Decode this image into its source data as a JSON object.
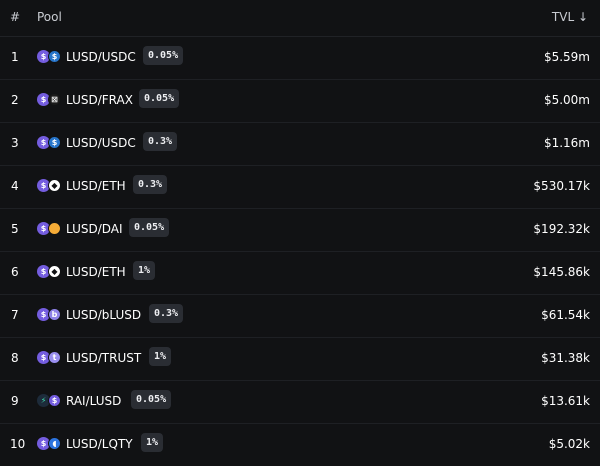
{
  "header": {
    "rank_label": "#",
    "pool_label": "Pool",
    "tvl_label": "TVL ↓"
  },
  "colors": {
    "background": "#111214",
    "lusd": "#745ddf",
    "usdc": "#2775ca",
    "frax": "#1b1b1b",
    "eth": "#ffffff",
    "dai": "#f5ac37",
    "blusd": "#8f83e8",
    "trust": "#9a8ff0",
    "rai": "#1d2b3a",
    "lqty": "#2c74e0",
    "fee_badge": "#2a2d33"
  },
  "rows": [
    {
      "rank": "1",
      "pair": "LUSD/USDC",
      "fee": "0.05%",
      "tvl": "$5.59m",
      "icons": [
        "lusd-icon",
        "usdc-icon"
      ]
    },
    {
      "rank": "2",
      "pair": "LUSD/FRAX",
      "fee": "0.05%",
      "tvl": "$5.00m",
      "icons": [
        "lusd-icon",
        "frax-icon"
      ]
    },
    {
      "rank": "3",
      "pair": "LUSD/USDC",
      "fee": "0.3%",
      "tvl": "$1.16m",
      "icons": [
        "lusd-icon",
        "usdc-icon"
      ]
    },
    {
      "rank": "4",
      "pair": "LUSD/ETH",
      "fee": "0.3%",
      "tvl": "$530.17k",
      "icons": [
        "lusd-icon",
        "eth-icon"
      ]
    },
    {
      "rank": "5",
      "pair": "LUSD/DAI",
      "fee": "0.05%",
      "tvl": "$192.32k",
      "icons": [
        "lusd-icon",
        "dai-icon"
      ]
    },
    {
      "rank": "6",
      "pair": "LUSD/ETH",
      "fee": "1%",
      "tvl": "$145.86k",
      "icons": [
        "lusd-icon",
        "eth-icon"
      ]
    },
    {
      "rank": "7",
      "pair": "LUSD/bLUSD",
      "fee": "0.3%",
      "tvl": "$61.54k",
      "icons": [
        "lusd-icon",
        "blusd-icon"
      ]
    },
    {
      "rank": "8",
      "pair": "LUSD/TRUST",
      "fee": "1%",
      "tvl": "$31.38k",
      "icons": [
        "lusd-icon",
        "trust-icon"
      ]
    },
    {
      "rank": "9",
      "pair": "RAI/LUSD",
      "fee": "0.05%",
      "tvl": "$13.61k",
      "icons": [
        "rai-icon",
        "lusd-icon"
      ]
    },
    {
      "rank": "10",
      "pair": "LUSD/LQTY",
      "fee": "1%",
      "tvl": "$5.02k",
      "icons": [
        "lusd-icon",
        "lqty-icon"
      ]
    }
  ]
}
